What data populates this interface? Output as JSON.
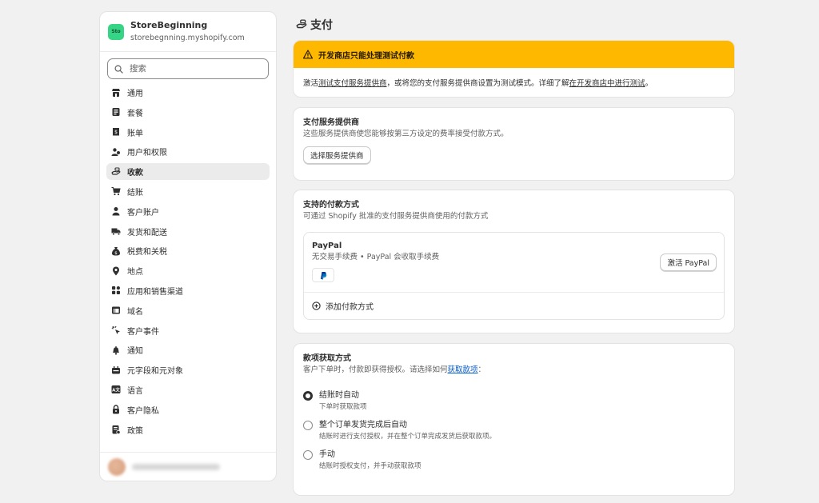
{
  "sidebar": {
    "store_logo_text": "Sto",
    "store_name": "StoreBeginning",
    "store_url": "storebegnning.myshopify.com",
    "search_placeholder": "搜索",
    "items": [
      {
        "label": "通用",
        "icon": "store-icon"
      },
      {
        "label": "套餐",
        "icon": "plan-icon"
      },
      {
        "label": "账单",
        "icon": "billing-icon"
      },
      {
        "label": "用户和权限",
        "icon": "users-icon"
      },
      {
        "label": "收款",
        "icon": "payments-icon",
        "active": true
      },
      {
        "label": "结账",
        "icon": "cart-icon"
      },
      {
        "label": "客户账户",
        "icon": "person-icon"
      },
      {
        "label": "发货和配送",
        "icon": "truck-icon"
      },
      {
        "label": "税费和关税",
        "icon": "tax-icon"
      },
      {
        "label": "地点",
        "icon": "location-icon"
      },
      {
        "label": "应用和销售渠道",
        "icon": "apps-icon"
      },
      {
        "label": "域名",
        "icon": "globe-icon"
      },
      {
        "label": "客户事件",
        "icon": "cursor-icon"
      },
      {
        "label": "通知",
        "icon": "bell-icon"
      },
      {
        "label": "元字段和元对象",
        "icon": "metafields-icon"
      },
      {
        "label": "语言",
        "icon": "language-icon"
      },
      {
        "label": "客户隐私",
        "icon": "lock-icon"
      },
      {
        "label": "政策",
        "icon": "policy-icon"
      }
    ]
  },
  "page": {
    "title": "支付"
  },
  "banner": {
    "title": "开发商店只能处理测试付款",
    "body_pre": "激活",
    "body_link1": "测试支付服务提供商",
    "body_mid": "，或将您的支付服务提供商设置为测试模式。详细了解",
    "body_link2": "在开发商店中进行测试",
    "body_post": "。"
  },
  "providers": {
    "title": "支付服务提供商",
    "subtitle": "这些服务提供商使您能够按第三方设定的费率接受付款方式。",
    "button": "选择服务提供商"
  },
  "methods": {
    "title": "支持的付款方式",
    "subtitle": "可通过 Shopify 批准的支付服务提供商使用的付款方式",
    "paypal_name": "PayPal",
    "paypal_fee": "无交易手续费 • PayPal 会收取手续费",
    "paypal_button": "激活 PayPal",
    "add_method": "添加付款方式"
  },
  "capture": {
    "title": "款项获取方式",
    "subtitle_pre": "客户下单时，付款即获得授权。请选择如何",
    "subtitle_link": "获取款项",
    "subtitle_post": "：",
    "options": [
      {
        "label": "结账时自动",
        "help": "下单时获取款项",
        "checked": true
      },
      {
        "label": "整个订单发货完成后自动",
        "help": "结账时进行支付授权，并在整个订单完成发货后获取款项。",
        "checked": false
      },
      {
        "label": "手动",
        "help": "结账时授权支付，并手动获取款项",
        "checked": false
      }
    ]
  }
}
